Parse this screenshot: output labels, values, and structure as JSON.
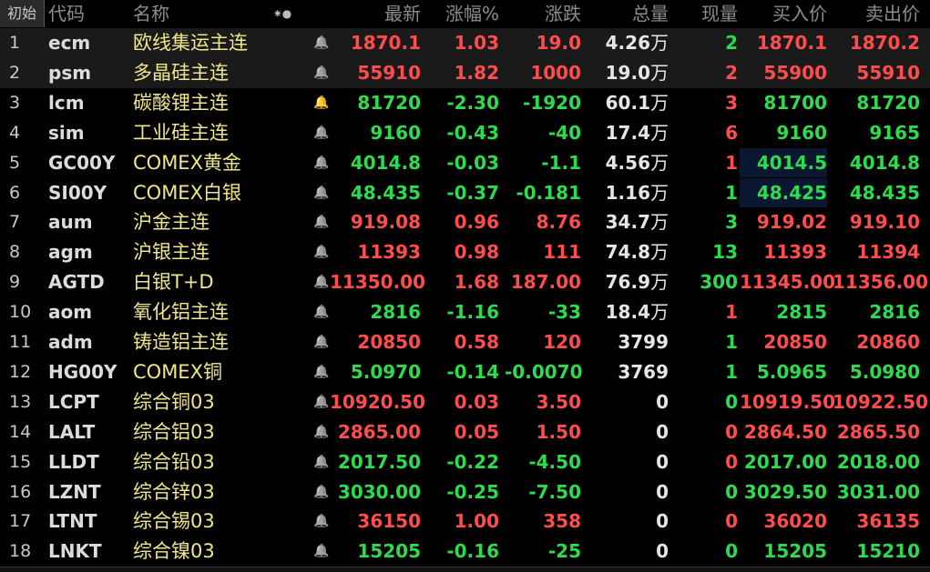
{
  "header": {
    "corner_label": "初始",
    "settings_glyph": "✷●",
    "columns": {
      "code": "代码",
      "name": "名称",
      "last": "最新",
      "pct": "涨幅%",
      "chg": "涨跌",
      "vol": "总量",
      "cur": "现量",
      "bid": "买入价",
      "ask": "卖出价"
    }
  },
  "colors": {
    "up": "#ff4d4d",
    "down": "#2edb4e",
    "name": "#f0e68c",
    "bell_alert": "#ff3b2f"
  },
  "rows": [
    {
      "idx": "1",
      "code": "ecm",
      "name": "欧线集运主连",
      "bell": "bell-icon",
      "last": "1870.1",
      "pct": "1.03",
      "chg": "19.0",
      "vol": "4.26",
      "vol_unit": "万",
      "cur": "2",
      "bid": "1870.1",
      "ask": "1870.2",
      "dir": "up",
      "cur_dir": "dn",
      "bid_dir": "up",
      "ask_dir": "up",
      "sel": true
    },
    {
      "idx": "2",
      "code": "psm",
      "name": "多晶硅主连",
      "bell": "bell-icon",
      "last": "55910",
      "pct": "1.82",
      "chg": "1000",
      "vol": "19.0",
      "vol_unit": "万",
      "cur": "2",
      "bid": "55900",
      "ask": "55910",
      "dir": "up",
      "cur_dir": "up",
      "bid_dir": "up",
      "ask_dir": "up",
      "sel": true
    },
    {
      "idx": "3",
      "code": "lcm",
      "name": "碳酸锂主连",
      "bell": "bell-alert-icon",
      "last": "81720",
      "pct": "-2.30",
      "chg": "-1920",
      "vol": "60.1",
      "vol_unit": "万",
      "cur": "3",
      "bid": "81700",
      "ask": "81720",
      "dir": "dn",
      "cur_dir": "up",
      "bid_dir": "dn",
      "ask_dir": "dn"
    },
    {
      "idx": "4",
      "code": "sim",
      "name": "工业硅主连",
      "bell": "bell-icon",
      "last": "9160",
      "pct": "-0.43",
      "chg": "-40",
      "vol": "17.4",
      "vol_unit": "万",
      "cur": "6",
      "bid": "9160",
      "ask": "9165",
      "dir": "dn",
      "cur_dir": "up",
      "bid_dir": "dn",
      "ask_dir": "dn"
    },
    {
      "idx": "5",
      "code": "GC00Y",
      "name": "COMEX黄金",
      "bell": "bell-icon",
      "last": "4014.8",
      "pct": "-0.03",
      "chg": "-1.1",
      "vol": "4.56",
      "vol_unit": "万",
      "cur": "1",
      "bid": "4014.5",
      "ask": "4014.8",
      "dir": "dn",
      "cur_dir": "up",
      "bid_dir": "dn",
      "ask_dir": "dn",
      "bidbox": true
    },
    {
      "idx": "6",
      "code": "SI00Y",
      "name": "COMEX白银",
      "bell": "bell-icon",
      "last": "48.435",
      "pct": "-0.37",
      "chg": "-0.181",
      "vol": "1.16",
      "vol_unit": "万",
      "cur": "1",
      "bid": "48.425",
      "ask": "48.435",
      "dir": "dn",
      "cur_dir": "dn",
      "bid_dir": "dn",
      "ask_dir": "dn",
      "bidbox": true
    },
    {
      "idx": "7",
      "code": "aum",
      "name": "沪金主连",
      "bell": "bell-icon",
      "last": "919.08",
      "pct": "0.96",
      "chg": "8.76",
      "vol": "34.7",
      "vol_unit": "万",
      "cur": "3",
      "bid": "919.02",
      "ask": "919.10",
      "dir": "up",
      "cur_dir": "dn",
      "bid_dir": "up",
      "ask_dir": "up"
    },
    {
      "idx": "8",
      "code": "agm",
      "name": "沪银主连",
      "bell": "bell-icon",
      "last": "11393",
      "pct": "0.98",
      "chg": "111",
      "vol": "74.8",
      "vol_unit": "万",
      "cur": "13",
      "bid": "11393",
      "ask": "11394",
      "dir": "up",
      "cur_dir": "dn",
      "bid_dir": "up",
      "ask_dir": "up"
    },
    {
      "idx": "9",
      "code": "AGTD",
      "name": "白银T+D",
      "bell": "bell-icon",
      "last": "11350.00",
      "pct": "1.68",
      "chg": "187.00",
      "vol": "76.9",
      "vol_unit": "万",
      "cur": "300",
      "bid": "11345.00",
      "ask": "11356.00",
      "dir": "up",
      "cur_dir": "dn",
      "bid_dir": "up",
      "ask_dir": "up"
    },
    {
      "idx": "10",
      "code": "aom",
      "name": "氧化铝主连",
      "bell": "bell-icon",
      "last": "2816",
      "pct": "-1.16",
      "chg": "-33",
      "vol": "18.4",
      "vol_unit": "万",
      "cur": "1",
      "bid": "2815",
      "ask": "2816",
      "dir": "dn",
      "cur_dir": "up",
      "bid_dir": "dn",
      "ask_dir": "dn"
    },
    {
      "idx": "11",
      "code": "adm",
      "name": "铸造铝主连",
      "bell": "bell-icon",
      "last": "20850",
      "pct": "0.58",
      "chg": "120",
      "vol": "3799",
      "vol_unit": "",
      "cur": "1",
      "bid": "20850",
      "ask": "20860",
      "dir": "up",
      "cur_dir": "dn",
      "bid_dir": "up",
      "ask_dir": "up"
    },
    {
      "idx": "12",
      "code": "HG00Y",
      "name": "COMEX铜",
      "bell": "bell-icon",
      "last": "5.0970",
      "pct": "-0.14",
      "chg": "-0.0070",
      "vol": "3769",
      "vol_unit": "",
      "cur": "1",
      "bid": "5.0965",
      "ask": "5.0980",
      "dir": "dn",
      "cur_dir": "dn",
      "bid_dir": "dn",
      "ask_dir": "dn"
    },
    {
      "idx": "13",
      "code": "LCPT",
      "name": "综合铜03",
      "bell": "bell-icon",
      "last": "10920.50",
      "pct": "0.03",
      "chg": "3.50",
      "vol": "0",
      "vol_unit": "",
      "cur": "0",
      "bid": "10919.50",
      "ask": "10922.50",
      "dir": "up",
      "cur_dir": "dn",
      "bid_dir": "up",
      "ask_dir": "up"
    },
    {
      "idx": "14",
      "code": "LALT",
      "name": "综合铝03",
      "bell": "bell-icon",
      "last": "2865.00",
      "pct": "0.05",
      "chg": "1.50",
      "vol": "0",
      "vol_unit": "",
      "cur": "0",
      "bid": "2864.50",
      "ask": "2865.50",
      "dir": "up",
      "cur_dir": "up",
      "bid_dir": "up",
      "ask_dir": "up"
    },
    {
      "idx": "15",
      "code": "LLDT",
      "name": "综合铅03",
      "bell": "bell-icon",
      "last": "2017.50",
      "pct": "-0.22",
      "chg": "-4.50",
      "vol": "0",
      "vol_unit": "",
      "cur": "0",
      "bid": "2017.00",
      "ask": "2018.00",
      "dir": "dn",
      "cur_dir": "up",
      "bid_dir": "dn",
      "ask_dir": "dn"
    },
    {
      "idx": "16",
      "code": "LZNT",
      "name": "综合锌03",
      "bell": "bell-icon",
      "last": "3030.00",
      "pct": "-0.25",
      "chg": "-7.50",
      "vol": "0",
      "vol_unit": "",
      "cur": "0",
      "bid": "3029.50",
      "ask": "3031.00",
      "dir": "dn",
      "cur_dir": "dn",
      "bid_dir": "dn",
      "ask_dir": "dn"
    },
    {
      "idx": "17",
      "code": "LTNT",
      "name": "综合锡03",
      "bell": "bell-icon",
      "last": "36150",
      "pct": "1.00",
      "chg": "358",
      "vol": "0",
      "vol_unit": "",
      "cur": "0",
      "bid": "36020",
      "ask": "36135",
      "dir": "up",
      "cur_dir": "up",
      "bid_dir": "up",
      "ask_dir": "up"
    },
    {
      "idx": "18",
      "code": "LNKT",
      "name": "综合镍03",
      "bell": "bell-icon",
      "last": "15205",
      "pct": "-0.16",
      "chg": "-25",
      "vol": "0",
      "vol_unit": "",
      "cur": "0",
      "bid": "15205",
      "ask": "15210",
      "dir": "dn",
      "cur_dir": "dn",
      "bid_dir": "dn",
      "ask_dir": "dn"
    }
  ]
}
